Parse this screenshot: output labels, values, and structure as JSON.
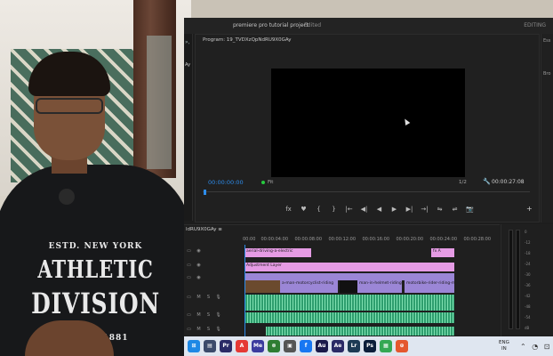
{
  "window": {
    "title": "premiere pro tutorial project",
    "status": "Edited",
    "workspace": "EDITING"
  },
  "left_strip": {
    "label1": "», ",
    "label2": "Ay"
  },
  "side_panel": {
    "label1": "Ess",
    "label2": "Bro"
  },
  "program_monitor": {
    "title": "Program: 19_TVDXzQpNdRU9X0GAy",
    "timecode_current": "00:00:00:00",
    "fit": "Fit",
    "resolution": "1/2",
    "timecode_duration": "00:00:27:08",
    "controls": [
      "fx",
      "♥",
      "{",
      "}",
      "|←",
      "◀|",
      "◀",
      "▶",
      "▶|",
      "→|",
      "⇋",
      "⇌",
      "📷"
    ],
    "plus": "+"
  },
  "timeline": {
    "sequence": "ldRU9X0GAy",
    "ticks": [
      "00:00",
      "00:00:04:00",
      "00:00:08:00",
      "00:00:12:00",
      "00:00:16:00",
      "00:00:20:00",
      "00:00:24:00",
      "00:00:28:00"
    ],
    "clips": {
      "top_pink": "aerial-driving-a-electric",
      "top_pink_right": "fx A",
      "adjustment": "Adjustment Layer",
      "v1_a": "a-man-motorcyclist-riding",
      "v1_b": "man-in-helmet-riding-b",
      "v1_c": "motorbike-rider-riding-m"
    }
  },
  "meter_labels": [
    "0",
    "-12",
    "-18",
    "-24",
    "-30",
    "-36",
    "-42",
    "-48",
    "-54",
    "dB"
  ],
  "taskbar": {
    "icons": [
      "⊞",
      "▤",
      "Pr",
      "A",
      "Me",
      "⊗",
      "▣",
      "f",
      "Au",
      "Ae",
      "Lr",
      "Ps",
      "▦",
      "⊕"
    ],
    "colors": [
      "#1e88e5",
      "#3b4a6b",
      "#2a2a66",
      "#e53935",
      "#3b3b9e",
      "#2e7d32",
      "#555555",
      "#1877f2",
      "#1a1a4a",
      "#2a2a66",
      "#1c3a54",
      "#0b1e3a",
      "#34a853",
      "#e4572e"
    ],
    "lang_line1": "ENG",
    "lang_line2": "IN",
    "system": "⌃ ◔ ⊡"
  },
  "shirt_print": {
    "line1": "ESTD. NEW YORK",
    "line2": "ATHLETIC",
    "line3": "DIVISION",
    "line4": "1881"
  }
}
